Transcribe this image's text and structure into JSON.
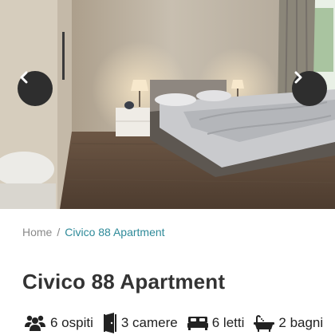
{
  "breadcrumb": {
    "home": "Home",
    "separator": "/",
    "current": "Civico 88 Apartment"
  },
  "title": "Civico 88 Apartment",
  "carousel": {
    "prev_icon": "chevron-left-icon",
    "next_icon": "chevron-right-icon"
  },
  "amenities": [
    {
      "icon": "users-icon",
      "label": "6 ospiti"
    },
    {
      "icon": "door-icon",
      "label": "3 camere"
    },
    {
      "icon": "bed-icon",
      "label": "6 letti"
    },
    {
      "icon": "bathtub-icon",
      "label": "2 bagni"
    }
  ],
  "colors": {
    "accent": "#2e8a99",
    "text": "#333333",
    "muted": "#8a8a8a",
    "nav_button": "#2e2e2e"
  }
}
